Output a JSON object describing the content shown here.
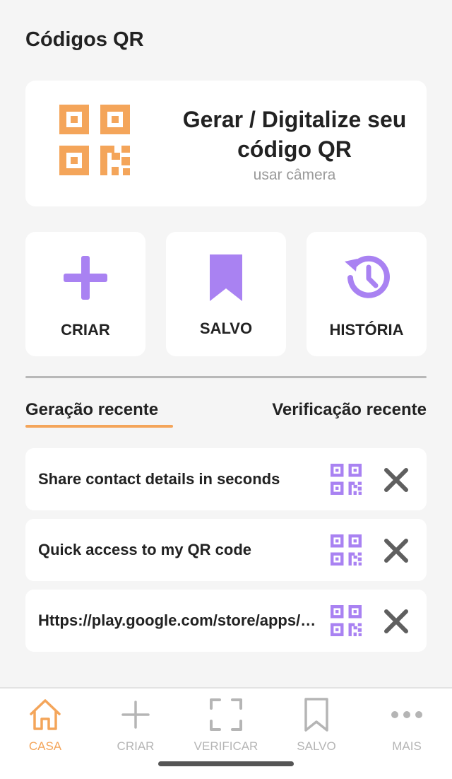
{
  "header": {
    "title": "Códigos QR"
  },
  "hero": {
    "title": "Gerar / Digitalize seu código QR",
    "subtitle": "usar câmera",
    "icon": "qr-code-icon"
  },
  "actions": [
    {
      "label": "CRIAR",
      "icon": "plus-icon"
    },
    {
      "label": "SALVO",
      "icon": "bookmark-icon"
    },
    {
      "label": "HISTÓRIA",
      "icon": "history-icon"
    }
  ],
  "tabs": [
    {
      "label": "Geração recente",
      "active": true
    },
    {
      "label": "Verificação recente",
      "active": false
    }
  ],
  "recent": [
    {
      "text": "Share contact details in seconds"
    },
    {
      "text": "Quick access to my QR code"
    },
    {
      "text": "Https://play.google.com/store/apps/details"
    }
  ],
  "bottom_nav": [
    {
      "label": "CASA",
      "icon": "home-icon",
      "active": true
    },
    {
      "label": "CRIAR",
      "icon": "plus-icon",
      "active": false
    },
    {
      "label": "VERIFICAR",
      "icon": "scan-icon",
      "active": false
    },
    {
      "label": "SALVO",
      "icon": "bookmark-icon",
      "active": false
    },
    {
      "label": "MAIS",
      "icon": "more-icon",
      "active": false
    }
  ],
  "colors": {
    "accent": "#f4a55a",
    "purple": "#a982f2",
    "inactive": "#b5b5b5",
    "close": "#5f5f5f"
  }
}
